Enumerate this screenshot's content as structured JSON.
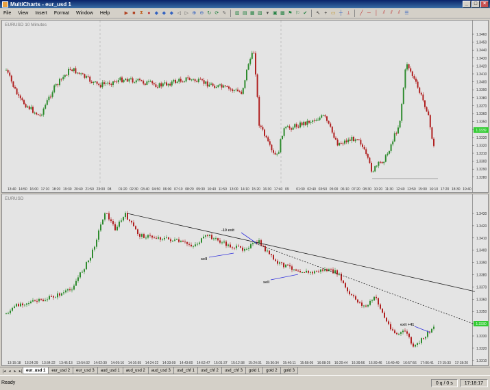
{
  "window": {
    "title": "MultiCharts - eur_usd 1"
  },
  "menu": [
    "File",
    "View",
    "Insert",
    "Format",
    "Window",
    "Help"
  ],
  "colors": {
    "up": "#2e8b2e",
    "down": "#b02020",
    "price_marker": "#33cc33",
    "drawing_blue": "#3333dd",
    "trendline": "#222222"
  },
  "pane1": {
    "label": "EURUSD  10 Minutes",
    "price_marker": "1.3339",
    "yticks": [
      "1.3460",
      "1.3450",
      "1.3440",
      "1.3430",
      "1.3420",
      "1.3410",
      "1.3400",
      "1.3390",
      "1.3380",
      "1.3370",
      "1.3360",
      "1.3350",
      "1.3340",
      "1.3330",
      "1.3320",
      "1.3310",
      "1.3300",
      "1.3290",
      "1.3280"
    ],
    "xticks": [
      "13:40",
      "14:50",
      "16:00",
      "17:10",
      "18:20",
      "19:30",
      "20:40",
      "21:50",
      "23:00",
      "08",
      "01:20",
      "02:30",
      "03:40",
      "04:50",
      "06:00",
      "07:10",
      "08:20",
      "09:30",
      "10:40",
      "11:50",
      "13:00",
      "14:10",
      "15:20",
      "16:30",
      "17:40",
      "09",
      "01:30",
      "02:40",
      "03:50",
      "05:00",
      "06:10",
      "07:20",
      "08:30",
      "10:20",
      "11:30",
      "12:40",
      "13:50",
      "15:00",
      "16:10",
      "17:20",
      "18:30",
      "19:40"
    ]
  },
  "pane2": {
    "label": "EURUSD",
    "price_marker": "1.3330",
    "yticks": [
      "1.3430",
      "1.3420",
      "1.3410",
      "1.3400",
      "1.3390",
      "1.3380",
      "1.3370",
      "1.3360",
      "1.3350",
      "1.3340",
      "1.3330",
      "1.3320",
      "1.3310"
    ],
    "xticks": [
      "13:15:18",
      "13:24:29",
      "13:34:22",
      "13:45:13",
      "13:54:32",
      "14:02:30",
      "14:09:16",
      "14:16:55",
      "14:24:22",
      "14:33:09",
      "14:43:00",
      "14:52:47",
      "15:01:37",
      "15:12:38",
      "15:24:31",
      "15:36:34",
      "15:46:11",
      "15:58:09",
      "16:08:25",
      "16:20:44",
      "16:39:56",
      "16:39:46",
      "16:49:49",
      "16:57:56",
      "17:06:41",
      "17:15:33",
      "17:18:20"
    ],
    "annotations": {
      "exit1": "-10 exit",
      "sell1": "sell",
      "sell2": "sell",
      "exit2": "exit +41"
    }
  },
  "tabs": [
    "eur_usd 1",
    "eur_usd 2",
    "eur_usd 3",
    "aud_usd 1",
    "aud_usd 2",
    "aud_usd 3",
    "usd_chf 1",
    "usd_chf 2",
    "usd_chf 3",
    "gold 1",
    "gold 2",
    "gold 3"
  ],
  "status": {
    "text": "Ready",
    "counter": "0 q / 0 s",
    "clock": "17:18:17"
  }
}
